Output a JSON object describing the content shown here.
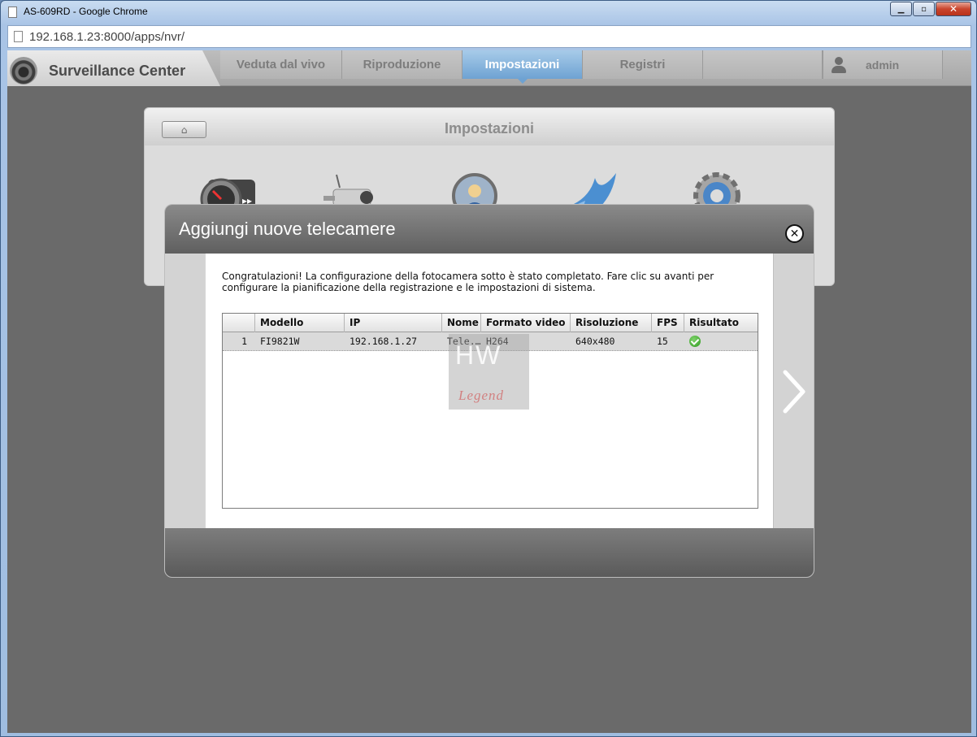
{
  "browser": {
    "window_title": "AS-609RD - Google Chrome",
    "url": "192.168.1.23:8000/apps/nvr/",
    "controls": {
      "minimize": "▁",
      "maximize": "▫",
      "close": "✕"
    }
  },
  "app": {
    "brand": "Surveillance Center",
    "nav": [
      {
        "label": "Veduta dal vivo"
      },
      {
        "label": "Riproduzione"
      },
      {
        "label": "Impostazioni",
        "active": true
      },
      {
        "label": "Registri"
      }
    ],
    "user": "admin"
  },
  "settings": {
    "title": "Impostazioni",
    "home_icon": "home-icon",
    "icons": [
      "speedometer-icon",
      "camera-icon",
      "user-badge-icon",
      "bird-icon",
      "gear-icon"
    ]
  },
  "modal": {
    "title": "Aggiungi nuove telecamere",
    "close_icon": "close-icon",
    "message": "Congratulazioni! La configurazione della fotocamera sotto è stato completato. Fare clic su avanti per configurare la pianificazione della registrazione e le impostazioni di sistema.",
    "next_icon": "chevron-right-icon",
    "table": {
      "columns": [
        "",
        "Modello",
        "IP",
        "Nome",
        "Formato video",
        "Risoluzione",
        "FPS",
        "Risultato"
      ],
      "rows": [
        {
          "index": "1",
          "model": "FI9821W",
          "ip": "192.168.1.27",
          "name": "Tele...",
          "format": "H264",
          "resolution": "640x480",
          "fps": "15",
          "result": "success-icon"
        }
      ]
    }
  },
  "watermark": {
    "top": "HW",
    "bottom": "Legend"
  },
  "colors": {
    "accent_tab": "#6ea2d2",
    "success": "#2f9a1f",
    "modal_header": "#5f5f5f"
  }
}
